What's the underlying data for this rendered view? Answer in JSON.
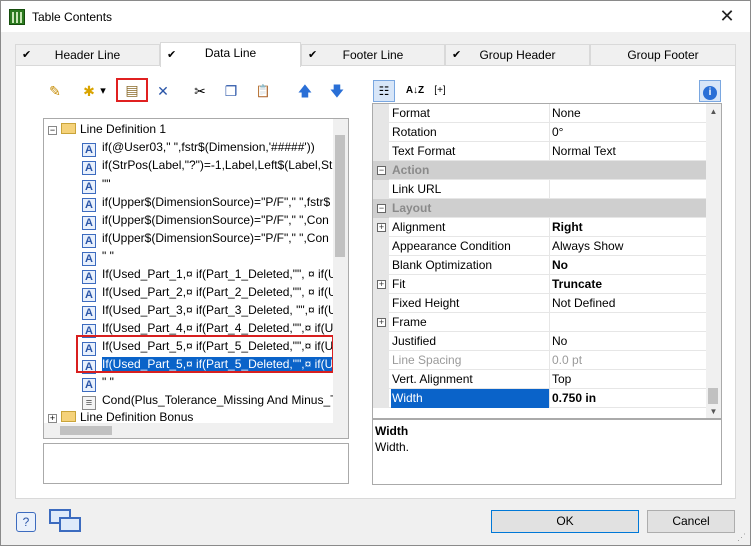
{
  "window": {
    "title": "Table Contents",
    "close_glyph": "✕"
  },
  "tabs": [
    {
      "label": "Header Line",
      "checked": true
    },
    {
      "label": "Data Line",
      "checked": true
    },
    {
      "label": "Footer Line",
      "checked": true
    },
    {
      "label": "Group Header",
      "checked": true
    },
    {
      "label": "Group Footer",
      "checked": false
    }
  ],
  "left_toolbar": [
    {
      "icon": "wand-icon",
      "glyph": "✎"
    },
    {
      "icon": "new-item-icon",
      "glyph": "✱"
    },
    {
      "icon": "dropdown-arrow-icon",
      "glyph": "▾"
    },
    {
      "icon": "properties-icon",
      "glyph": "▤"
    },
    {
      "icon": "delete-icon",
      "glyph": "✕"
    },
    {
      "icon": "cut-icon",
      "glyph": "✂"
    },
    {
      "icon": "copy-icon",
      "glyph": "❐"
    },
    {
      "icon": "paste-icon",
      "glyph": "📋"
    },
    {
      "icon": "move-up-icon",
      "glyph": "🡅"
    },
    {
      "icon": "move-down-icon",
      "glyph": "🡇"
    }
  ],
  "tree": {
    "root_label": "Line Definition  1",
    "items": [
      "if(@User03,\" \",fstr$(Dimension,'#####'))",
      "if(StrPos(Label,\"?\")=-1,Label,Left$(Label,Str",
      "\"\"",
      "if(Upper$(DimensionSource)=\"P/F\",\" \",fstr$",
      "if(Upper$(DimensionSource)=\"P/F\",\" \",Con",
      "if(Upper$(DimensionSource)=\"P/F\",\" \",Con",
      "\" \"",
      "If(Used_Part_1,¤ if(Part_1_Deleted,\"\", ¤  if(U",
      "If(Used_Part_2,¤ if(Part_2_Deleted,\"\", ¤  if(U",
      "If(Used_Part_3,¤ if(Part_3_Deleted, \"\",¤  if(U",
      "If(Used_Part_4,¤ if(Part_4_Deleted,\"\",¤  if(U",
      "If(Used_Part_5,¤ if(Part_5_Deleted,\"\",¤  if(U",
      "If(Used_Part_5,¤ if(Part_5_Deleted,\"\",¤  if(U",
      "\" \"",
      "Cond(Plus_Tolerance_Missing And Minus_T"
    ],
    "second_root_label": "Line Definition Bonus"
  },
  "right_toolbar": {
    "categorized_glyph": "☷",
    "sort_glyph": "A↓Z",
    "expand_label": "[+]",
    "info_glyph": "i"
  },
  "properties": [
    {
      "kind": "prop",
      "name": "Format",
      "value": "None"
    },
    {
      "kind": "prop",
      "name": "Rotation",
      "value": "0°"
    },
    {
      "kind": "prop",
      "name": "Text Format",
      "value": "Normal Text"
    },
    {
      "kind": "cat",
      "name": "Action"
    },
    {
      "kind": "prop",
      "name": "Link URL",
      "value": ""
    },
    {
      "kind": "cat",
      "name": "Layout"
    },
    {
      "kind": "prop",
      "name": "Alignment",
      "value": "Right",
      "expandable": true,
      "bold": true
    },
    {
      "kind": "prop",
      "name": "Appearance Condition",
      "value": "Always Show"
    },
    {
      "kind": "prop",
      "name": "Blank Optimization",
      "value": "No",
      "bold": true
    },
    {
      "kind": "prop",
      "name": "Fit",
      "value": "Truncate",
      "expandable": true,
      "bold": true
    },
    {
      "kind": "prop",
      "name": "Fixed Height",
      "value": "Not Defined"
    },
    {
      "kind": "prop",
      "name": "Frame",
      "value": "",
      "expandable": true
    },
    {
      "kind": "prop",
      "name": "Justified",
      "value": "No"
    },
    {
      "kind": "prop",
      "name": "Line Spacing",
      "value": "0.0 pt",
      "dim": true
    },
    {
      "kind": "prop",
      "name": "Vert. Alignment",
      "value": "Top"
    },
    {
      "kind": "prop",
      "name": "Width",
      "value": "0.750 in",
      "bold": true,
      "selected": true
    }
  ],
  "description": {
    "title": "Width",
    "text": "Width."
  },
  "buttons": {
    "ok": "OK",
    "cancel": "Cancel",
    "help_glyph": "?"
  }
}
